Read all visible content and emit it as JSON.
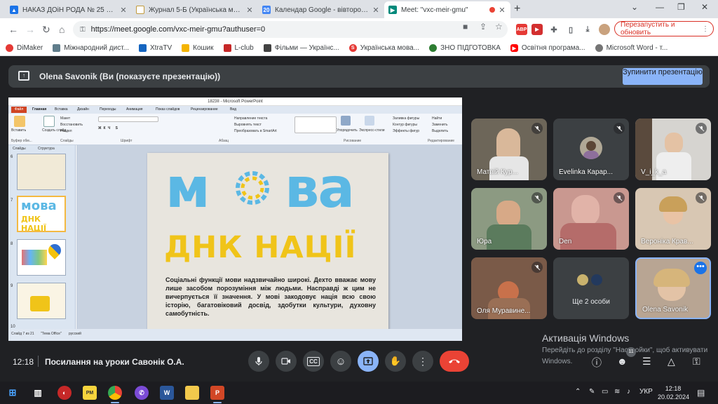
{
  "browser": {
    "tabs": [
      {
        "title": "НАКАЗ ДОіН РОДА № 25 від 0..."
      },
      {
        "title": "Журнал 5-Б (Українська мова ("
      },
      {
        "title": "Календар Google - вівторок, 20..."
      },
      {
        "title": "Meet: \"vxc-meir-gmu\""
      }
    ],
    "new_tab": "+",
    "window_controls": [
      "⌄",
      "—",
      "❐",
      "✕"
    ],
    "url": "https://meet.google.com/vxc-meir-gmu?authuser=0",
    "restart_label": "Перезапустить и обновить",
    "extensions": [
      "ABP"
    ],
    "bookmarks": [
      "DiMaker",
      "Міжнародний дист...",
      "XtraTV",
      "Кошик",
      "L-club",
      "Фільми — Українс...",
      "Українська мова...",
      "ЗНО ПІДГОТОВКА",
      "Освітня програма...",
      "Microsoft Word - т..."
    ]
  },
  "meet": {
    "presenting_text": "Olena Savonik (Ви (показуєте презентацію))",
    "stop_label": "Зупинити презентацію",
    "time": "12:18",
    "meeting_title": "Посилання на уроки Савонік О.А.",
    "people_badge": "11",
    "participants": [
      {
        "name": "Матвій Кур..."
      },
      {
        "name": "Evelinka Карар..."
      },
      {
        "name": "V_і_k_a"
      },
      {
        "name": "Юра"
      },
      {
        "name": "Den"
      },
      {
        "name": "Вероніка Крав..."
      },
      {
        "name": "Оля Муравине..."
      },
      {
        "name": "Ще 2 особи"
      },
      {
        "name": "Olena Savonik"
      }
    ],
    "more_dots": "•••",
    "watermark_title": "Активація Windows",
    "watermark_text": "Перейдіть до розділу \"Настройки\", щоб активувати Windows."
  },
  "powerpoint": {
    "window_title": "1823II - Microsoft PowerPoint",
    "file_tab": "Файл",
    "ribbon_tabs": [
      "Главная",
      "Вставка",
      "Дизайн",
      "Переходы",
      "Анимация",
      "Показ слайдов",
      "Рецензирование",
      "Вид"
    ],
    "ribbon_items": [
      "Вставить",
      "Создать слайд",
      "Макет",
      "Восстановить",
      "Раздел",
      "Упорядочить",
      "Экспресс-стили",
      "Заливка фигуры",
      "Контур фигуры",
      "Эффекты фигур",
      "Найти",
      "Заменить",
      "Выделить",
      "Направление текста",
      "Выровнять текст",
      "Преобразовать в SmartArt"
    ],
    "ribbon_groups": [
      "Буфер обм...",
      "Слайды",
      "Шрифт",
      "Абзац",
      "Рисование",
      "Редактирование"
    ],
    "panel_tabs": [
      "Слайды",
      "Структура"
    ],
    "thumb_numbers": [
      "6",
      "7",
      "8",
      "9",
      "10"
    ],
    "status": [
      "Слайд 7 из 21",
      "\"Тема Office\"",
      "русский"
    ]
  },
  "slide": {
    "word_left": "м",
    "word_right": "ва",
    "subtitle": "ДНК НАЦІЇ",
    "body": "Соціальні функції мови надзвичайно широкі. Дехто вважає мову лише засобом порозуміння між людьми. Насправді ж цим не вичерпується її значення. У мові закодовує нація всю свою історію, багатовіковий досвід, здобутки культури, духовну самобутність."
  },
  "taskbar": {
    "lang": "УКР",
    "time": "12:18",
    "date": "20.02.2024"
  },
  "colors": {
    "meet_bg": "#202124",
    "tile_bg": "#3c4043",
    "accent_blue": "#8ab4f8",
    "end_red": "#ea4335",
    "slide_blue": "#5bb8e4",
    "slide_yellow": "#f0c419"
  }
}
